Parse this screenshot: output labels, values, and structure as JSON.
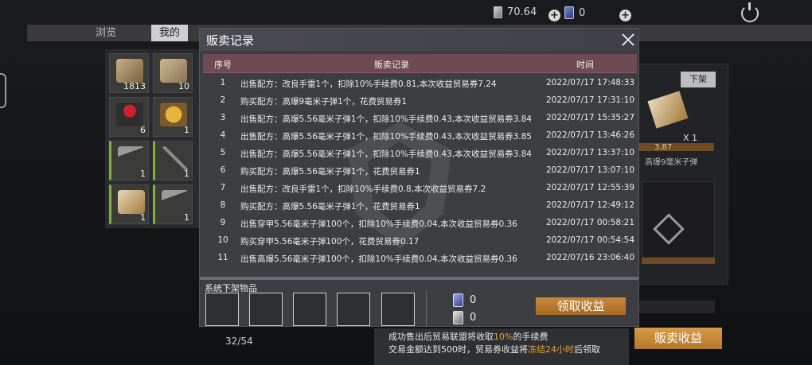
{
  "topbar": {
    "ticket_value": "70.64",
    "card_value": "0"
  },
  "tabs": [
    {
      "label": "浏览"
    },
    {
      "label": "我的"
    }
  ],
  "inventory": {
    "items": [
      {
        "name": "wood-logs",
        "count": "1813"
      },
      {
        "name": "cloth-roll",
        "count": "10"
      },
      {
        "name": "rose",
        "count": "6"
      },
      {
        "name": "food-bowl",
        "count": "1"
      },
      {
        "name": "hammer",
        "count": "1"
      },
      {
        "name": "sling-tool",
        "count": "1"
      },
      {
        "name": "recipe-card",
        "count": "1"
      },
      {
        "name": "hammer-2",
        "count": "1"
      }
    ],
    "page_count": "32/54"
  },
  "right_panel": {
    "offshelf_label": "下架",
    "quantity": "X 1",
    "price": "3.87",
    "recipe_text": "方：高爆9毫米子弹"
  },
  "modal": {
    "title": "贩卖记录",
    "columns": {
      "no": "序号",
      "record": "贩卖记录",
      "time": "时间"
    },
    "rows": [
      {
        "no": "1",
        "record": "出售配方：改良手雷1个，扣除10%手续费0.81,本次收益贸易券7.24",
        "time": "2022/07/17 17:48:33"
      },
      {
        "no": "2",
        "record": "购买配方：高爆9毫米子弹1个，花费贸易券1",
        "time": "2022/07/17 17:31:10"
      },
      {
        "no": "3",
        "record": "出售配方：高爆5.56毫米子弹1个，扣除10%手续费0.43,本次收益贸易券3.84",
        "time": "2022/07/17 15:35:27"
      },
      {
        "no": "4",
        "record": "出售配方：高爆5.56毫米子弹1个，扣除10%手续费0.43,本次收益贸易券3.85",
        "time": "2022/07/17 13:46:26"
      },
      {
        "no": "5",
        "record": "出售配方：高爆5.56毫米子弹1个，扣除10%手续费0.43,本次收益贸易券3.84",
        "time": "2022/07/17 13:37:10"
      },
      {
        "no": "6",
        "record": "购买配方：高爆5.56毫米子弹1个，花费贸易券1",
        "time": "2022/07/17 13:07:10"
      },
      {
        "no": "7",
        "record": "出售配方：改良手雷1个，扣除10%手续费0.8,本次收益贸易券7.2",
        "time": "2022/07/17 12:55:39"
      },
      {
        "no": "8",
        "record": "购买配方：高爆5.56毫米子弹1个，花费贸易券1",
        "time": "2022/07/17 12:49:12"
      },
      {
        "no": "9",
        "record": "出售穿甲5.56毫米子弹100个，扣除10%手续费0.04,本次收益贸易券0.36",
        "time": "2022/07/17 00:58:21"
      },
      {
        "no": "10",
        "record": "购买穿甲5.56毫米子弹100个，花费贸易券0.17",
        "time": "2022/07/17 00:54:54"
      },
      {
        "no": "11",
        "record": "出售高爆5.56毫米子弹100个，扣除10%手续费0.04,本次收益贸易券0.36",
        "time": "2022/07/16 23:06:40"
      }
    ],
    "system_label": "系统下架物品",
    "card_amount": "0",
    "ticket_amount": "0",
    "collect_label": "领取收益"
  },
  "bottom": {
    "line1_a": "成功售出后贸易联盟将收取",
    "line1_hl": "10%",
    "line1_b": "的手续费",
    "line2_a": "交易金额达到500时，贸易券收益将",
    "line2_hl": "冻结24小时",
    "line2_b": "后领取",
    "sell_income_label": "贩卖收益"
  },
  "colors": {
    "accent_orange": "#c9893d",
    "header_wine": "#6f4a52",
    "highlight": "#e3a23c"
  }
}
